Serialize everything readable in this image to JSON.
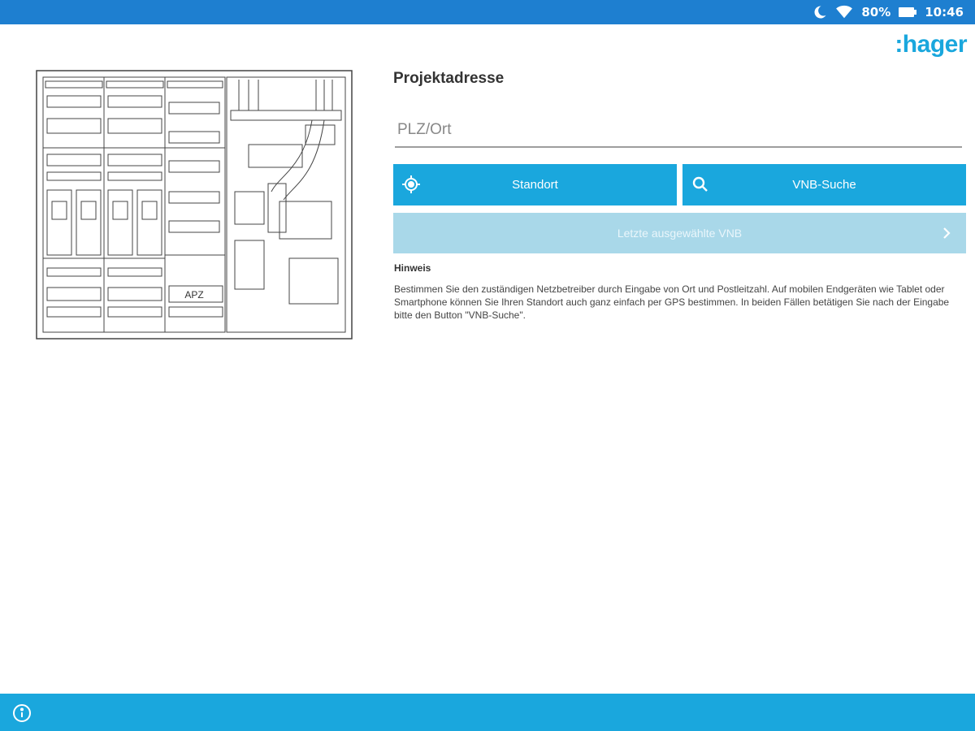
{
  "status_bar": {
    "battery_percent": "80%",
    "time": "10:46"
  },
  "brand": {
    "logo_text": ":hager",
    "accent": "#1aa7dd",
    "status_bar_color": "#1e7fd0"
  },
  "diagram": {
    "label": "APZ"
  },
  "form": {
    "title": "Projektadresse",
    "location_placeholder": "PLZ/Ort",
    "standort_label": "Standort",
    "vnb_search_label": "VNB-Suche",
    "last_selected_label": "Letzte ausgewählte VNB"
  },
  "hint": {
    "title": "Hinweis",
    "text": "Bestimmen Sie den zuständigen Netzbetreiber durch Eingabe von Ort und Postleitzahl. Auf mobilen Endgeräten wie Tablet oder Smartphone können Sie Ihren Standort auch ganz einfach per GPS bestimmen. In beiden Fällen betätigen Sie nach der Eingabe bitte den Button \"VNB-Suche\"."
  },
  "icons": {
    "status": [
      "moon-icon",
      "wifi-icon",
      "battery-icon"
    ],
    "buttons": [
      "crosshair-icon",
      "search-icon",
      "chevron-right-icon"
    ],
    "footer": [
      "info-icon"
    ]
  }
}
